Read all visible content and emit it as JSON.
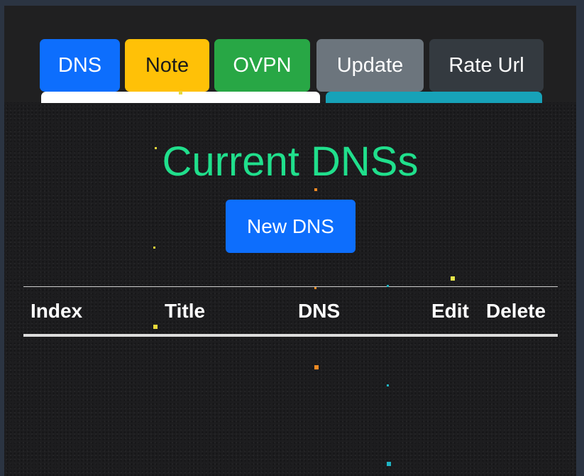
{
  "nav": {
    "dns_label": "DNS",
    "note_label": "Note",
    "ovpn_label": "OVPN",
    "update_label": "Update",
    "rate_label": "Rate Url"
  },
  "main": {
    "title": "Current DNSs",
    "new_button_label": "New DNS"
  },
  "table": {
    "columns": [
      "Index",
      "Title",
      "DNS",
      "Edit",
      "Delete"
    ],
    "rows": []
  },
  "colors": {
    "primary": "#0d6efd",
    "warning": "#ffc107",
    "success": "#28a745",
    "secondary": "#6c757d",
    "dark": "#343a40",
    "title_green": "#20df8c",
    "info": "#17a2b8"
  }
}
